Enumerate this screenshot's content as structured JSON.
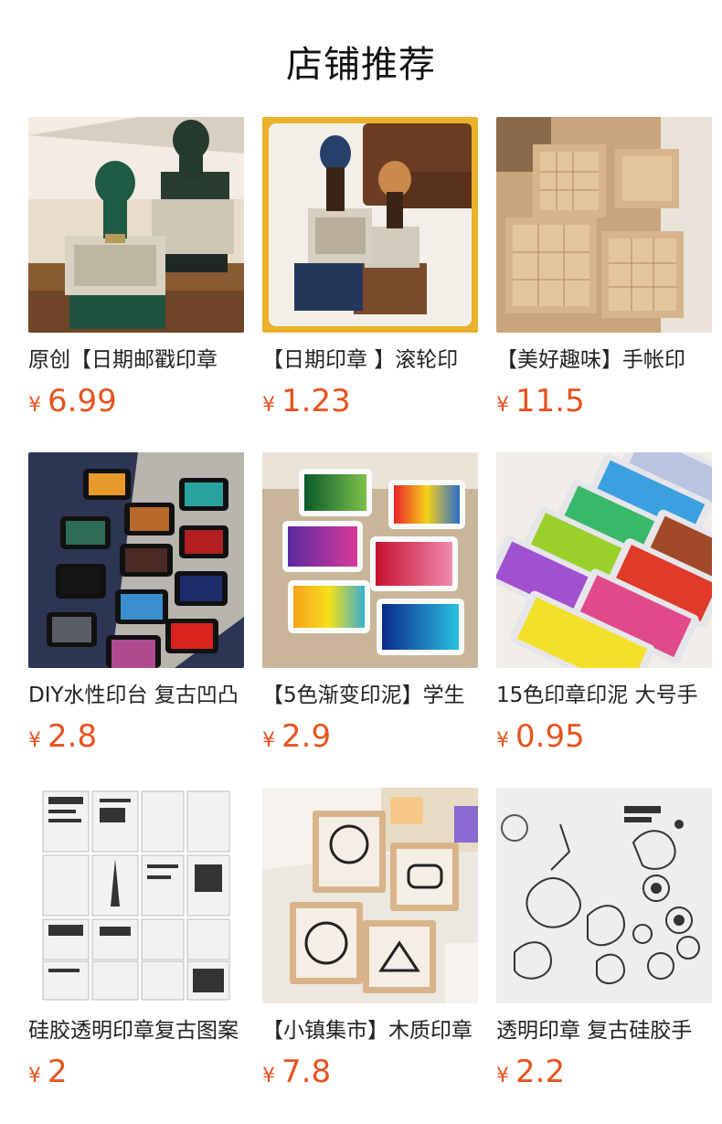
{
  "section_title": "店铺推荐",
  "colors": {
    "price": "#e8531f",
    "title": "#111111",
    "name": "#222222"
  },
  "products": [
    {
      "name": "原创【日期邮戳印章",
      "currency": "¥",
      "price": "6.99",
      "image": "date-roller-stamps-green-black"
    },
    {
      "name": "【日期印章 】滚轮印",
      "currency": "¥",
      "price": "1.23",
      "image": "date-roller-stamps-navy-wood"
    },
    {
      "name": "【美好趣味】手帐印",
      "currency": "¥",
      "price": "11.5",
      "image": "wooden-rubber-stamp-sets"
    },
    {
      "name": "DIY水性印台 复古凹凸",
      "currency": "¥",
      "price": "2.8",
      "image": "colored-ink-pads"
    },
    {
      "name": "【5色渐变印泥】学生",
      "currency": "¥",
      "price": "2.9",
      "image": "gradient-craft-ink-pads"
    },
    {
      "name": "15色印章印泥 大号手",
      "currency": "¥",
      "price": "0.95",
      "image": "rainbow-ink-pads-stack"
    },
    {
      "name": "硅胶透明印章复古图案",
      "currency": "¥",
      "price": "2",
      "image": "clear-silicone-stamp-sheets"
    },
    {
      "name": "【小镇集市】木质印章",
      "currency": "¥",
      "price": "7.8",
      "image": "cartoon-wooden-stamps"
    },
    {
      "name": "透明印章 复古硅胶手",
      "currency": "¥",
      "price": "2.2",
      "image": "clear-floral-stamps"
    }
  ]
}
